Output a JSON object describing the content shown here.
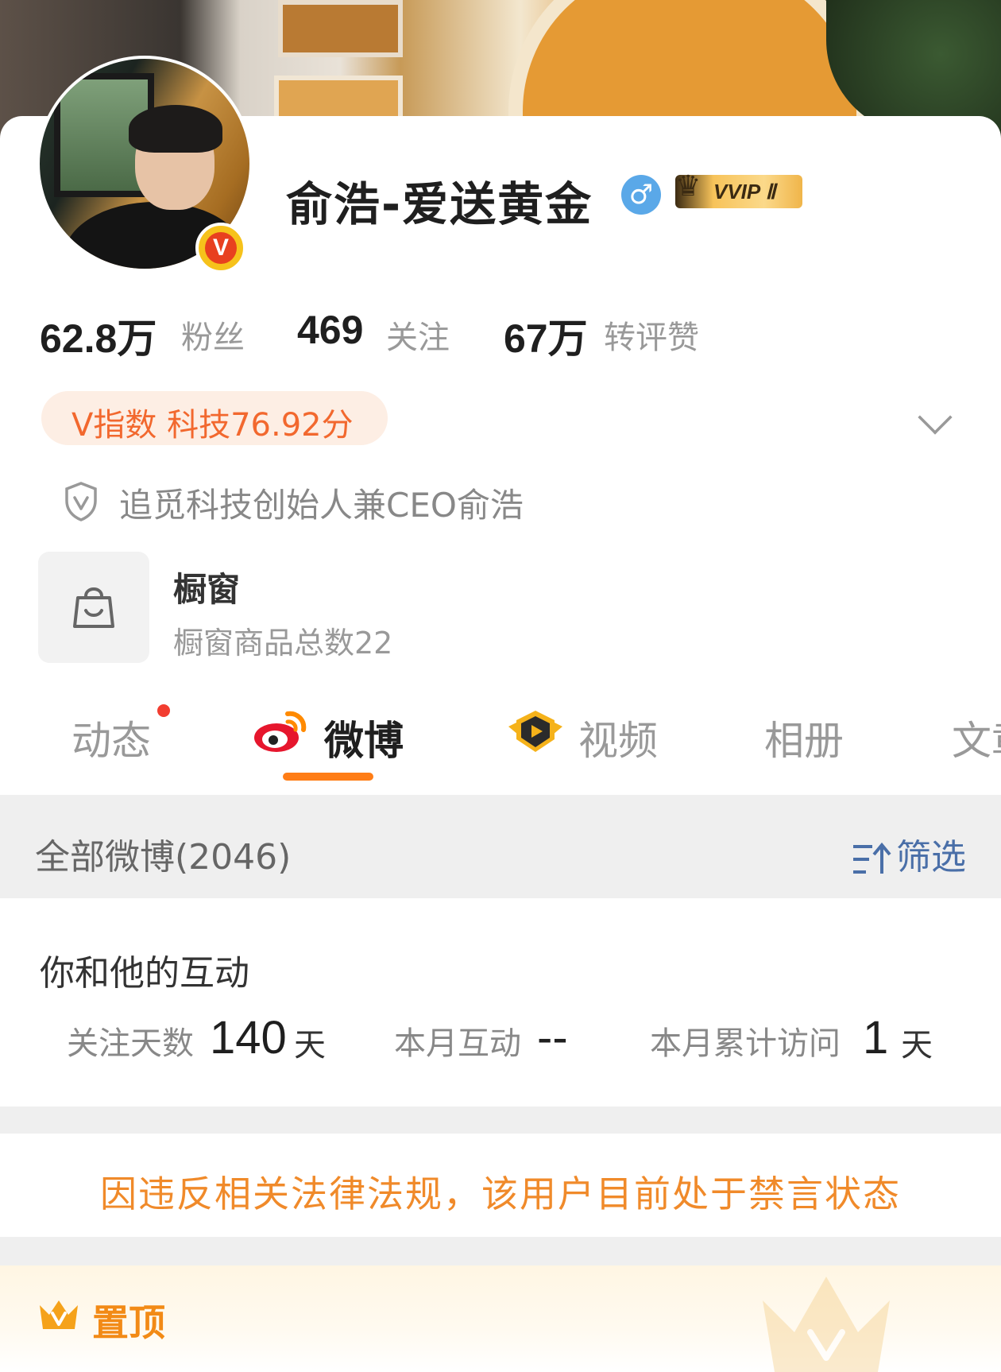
{
  "profile": {
    "name": "俞浩-爱送黄金",
    "gender_symbol": "♂",
    "vip_badge": "VVIP Ⅱ",
    "verified_badge": "V"
  },
  "stats": [
    {
      "value": "62.8万",
      "label": "粉丝"
    },
    {
      "value": "469",
      "label": "关注"
    },
    {
      "value": "67万",
      "label": "转评赞"
    }
  ],
  "v_index": "V指数 科技76.92分",
  "verification": "追觅科技创始人兼CEO俞浩",
  "showcase": {
    "title": "橱窗",
    "subtitle": "橱窗商品总数22"
  },
  "tabs": [
    {
      "label": "动态"
    },
    {
      "label": "微博"
    },
    {
      "label": "视频"
    },
    {
      "label": "相册"
    },
    {
      "label": "文章"
    }
  ],
  "filter_bar": {
    "all_posts": "全部微博(2046)",
    "filter_label": "筛选"
  },
  "interaction": {
    "title": "你和他的互动",
    "follow_days_label": "关注天数",
    "follow_days_value": "140",
    "follow_days_unit": "天",
    "monthly_label": "本月互动",
    "monthly_value": "--",
    "visits_label": "本月累计访问",
    "visits_value": "1",
    "visits_unit": "天"
  },
  "ban_notice": "因违反相关法律法规，该用户目前处于禁言状态",
  "pinned_label": "置顶",
  "colors": {
    "accent_orange": "#ff7d16",
    "ban_text": "#f08a2a",
    "v_index_text": "#f2682e",
    "filter_blue": "#4a6fa8"
  }
}
